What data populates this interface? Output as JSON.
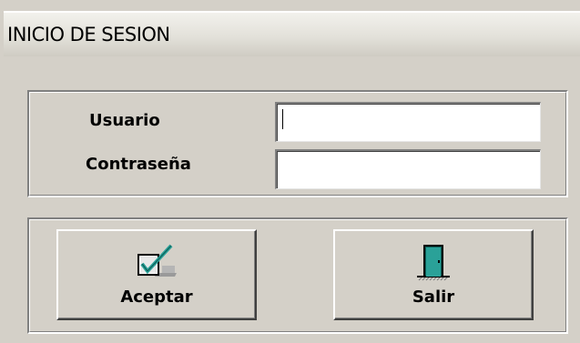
{
  "window": {
    "title": "INICIO DE SESION"
  },
  "credentials": {
    "username_label": "Usuario",
    "username_value": "",
    "password_label": "Contraseña",
    "password_value": ""
  },
  "buttons": {
    "accept_label": "Aceptar",
    "accept_icon": "checkbox-check-icon",
    "exit_label": "Salir",
    "exit_icon": "door-exit-icon"
  },
  "colors": {
    "background": "#d4d0c8",
    "accent_teal": "#2aa198"
  }
}
